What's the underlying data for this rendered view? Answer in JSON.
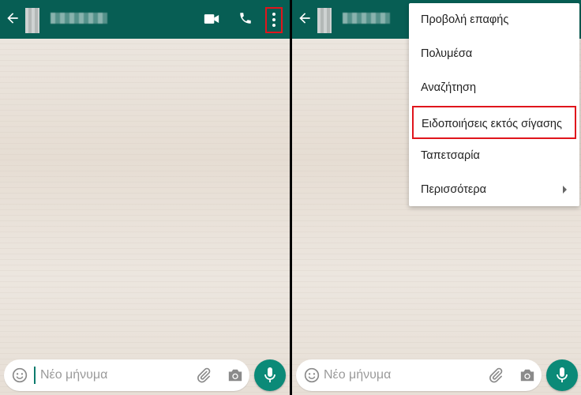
{
  "left": {
    "input_placeholder": "Νέο μήνυμα"
  },
  "right": {
    "input_placeholder": "Νέο μήνυμα",
    "menu": [
      {
        "label": "Προβολή επαφής"
      },
      {
        "label": "Πολυμέσα"
      },
      {
        "label": "Αναζήτηση"
      },
      {
        "label": "Ειδοποιήσεις εκτός σίγασης"
      },
      {
        "label": "Ταπετσαρία"
      },
      {
        "label": "Περισσότερα"
      }
    ]
  },
  "colors": {
    "toolbar": "#075e54",
    "accent": "#0b8a78",
    "highlight": "#e0151c"
  },
  "icons": [
    "back-arrow-icon",
    "video-call-icon",
    "voice-call-icon",
    "more-options-icon",
    "emoji-icon",
    "attach-icon",
    "camera-icon",
    "mic-icon",
    "submenu-arrow-icon"
  ]
}
